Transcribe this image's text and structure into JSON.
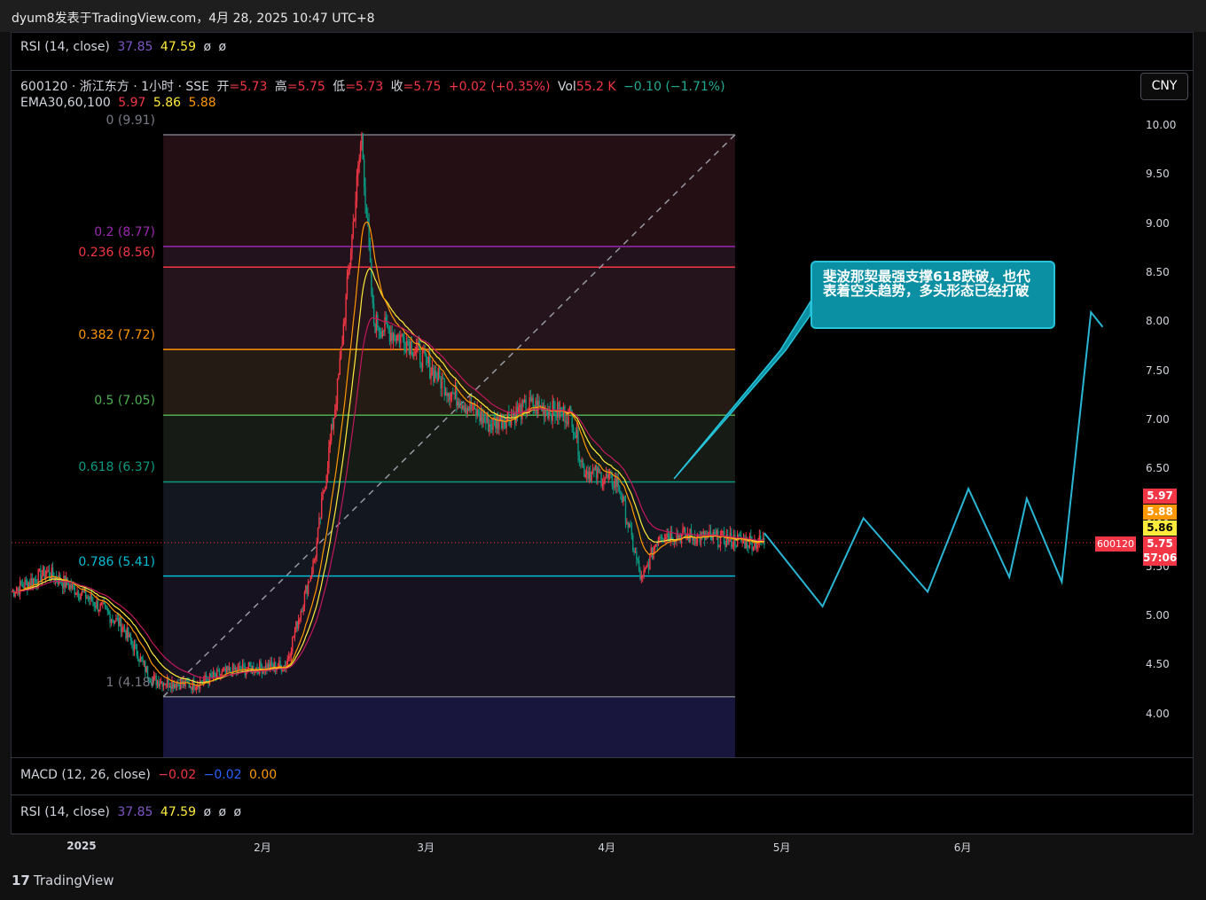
{
  "header": {
    "publish_line": "dyum8发表于TradingView.com，4月 28, 2025 10:47 UTC+8"
  },
  "top_rsi": {
    "label": "RSI (14, close)",
    "v1": "37.85",
    "v2": "47.59",
    "e1": "ø",
    "e2": "ø"
  },
  "symbol_legend": {
    "title": "600120 · 浙江东方 · 1小时 · SSE",
    "open_label": "开",
    "open": "=5.73",
    "high_label": "高",
    "high": "=5.75",
    "low_label": "低",
    "low": "=5.73",
    "close_label": "收",
    "close": "=5.75",
    "change": "+0.02 (+0.35%)",
    "vol_label": "Vol",
    "vol": "55.2 K",
    "vol_change": "−0.10 (−1.71%)"
  },
  "ema_legend": {
    "label": "EMA30,60,100",
    "e30": "5.97",
    "e60": "5.86",
    "e100": "5.88"
  },
  "currency_button": "CNY",
  "fib_levels": [
    {
      "label": "0 (9.91)",
      "price": 9.91,
      "color": "#787b86"
    },
    {
      "label": "0.2 (8.77)",
      "price": 8.77,
      "color": "#9c27b0"
    },
    {
      "label": "0.236 (8.56)",
      "price": 8.56,
      "color": "#f23645"
    },
    {
      "label": "0.382 (7.72)",
      "price": 7.72,
      "color": "#ff9800"
    },
    {
      "label": "0.5 (7.05)",
      "price": 7.05,
      "color": "#4caf50"
    },
    {
      "label": "0.618 (6.37)",
      "price": 6.37,
      "color": "#089981"
    },
    {
      "label": "0.786 (5.41)",
      "price": 5.41,
      "color": "#00bcd4"
    },
    {
      "label": "1 (4.18)",
      "price": 4.18,
      "color": "#787b86"
    }
  ],
  "annotation": "斐波那契最强支撑618跌破，也代表着空头趋势，多头形态已经打破",
  "price_boxes": {
    "ema30": {
      "value": "5.97",
      "color": "#f23645"
    },
    "ema100": {
      "value": "5.88",
      "color": "#ff9800"
    },
    "ema60": {
      "value": "5.86",
      "color": "#ffeb3b"
    },
    "last": {
      "value": "5.75",
      "countdown": "57:06",
      "color": "#f23645"
    },
    "symbol_tag": "600120"
  },
  "macd": {
    "label": "MACD (12, 26, close)",
    "v1": "−0.02",
    "v2": "−0.02",
    "v3": "0.00"
  },
  "bottom_rsi": {
    "label": "RSI (14, close)",
    "v1": "37.85",
    "v2": "47.59",
    "e1": "ø",
    "e2": "ø",
    "e3": "ø"
  },
  "logo_text": "TradingView",
  "chart_data": {
    "type": "candlestick",
    "symbol": "600120",
    "interval": "1小时",
    "y_ticks": [
      10.0,
      9.5,
      9.0,
      8.5,
      8.0,
      7.5,
      7.0,
      6.5,
      6.0,
      5.5,
      5.0,
      4.5,
      4.0
    ],
    "ylim": [
      3.55,
      10.05
    ],
    "x_ticks": [
      "2025",
      "2月",
      "3月",
      "4月",
      "5月",
      "6月"
    ],
    "price_path": [
      {
        "t": "2024-12-20",
        "p": 5.25
      },
      {
        "t": "2024-12-26",
        "p": 5.45
      },
      {
        "t": "2025-01-02",
        "p": 5.2
      },
      {
        "t": "2025-01-08",
        "p": 4.9
      },
      {
        "t": "2025-01-13",
        "p": 4.35
      },
      {
        "t": "2025-01-20",
        "p": 4.3
      },
      {
        "t": "2025-01-27",
        "p": 4.45
      },
      {
        "t": "2025-02-05",
        "p": 4.5
      },
      {
        "t": "2025-02-10",
        "p": 5.6
      },
      {
        "t": "2025-02-14",
        "p": 7.4
      },
      {
        "t": "2025-02-18",
        "p": 9.91
      },
      {
        "t": "2025-02-20",
        "p": 8.0
      },
      {
        "t": "2025-02-26",
        "p": 7.8
      },
      {
        "t": "2025-03-05",
        "p": 7.3
      },
      {
        "t": "2025-03-12",
        "p": 6.95
      },
      {
        "t": "2025-03-19",
        "p": 7.15
      },
      {
        "t": "2025-03-26",
        "p": 7.05
      },
      {
        "t": "2025-03-28",
        "p": 6.5
      },
      {
        "t": "2025-04-03",
        "p": 6.35
      },
      {
        "t": "2025-04-07",
        "p": 5.35
      },
      {
        "t": "2025-04-10",
        "p": 5.85
      },
      {
        "t": "2025-04-18",
        "p": 5.8
      },
      {
        "t": "2025-04-28",
        "p": 5.75
      }
    ],
    "projection": [
      {
        "t": "2025-04-28",
        "p": 5.85
      },
      {
        "t": "2025-05-08",
        "p": 5.1
      },
      {
        "t": "2025-05-15",
        "p": 6.0
      },
      {
        "t": "2025-05-26",
        "p": 5.25
      },
      {
        "t": "2025-06-02",
        "p": 6.3
      },
      {
        "t": "2025-06-09",
        "p": 5.4
      },
      {
        "t": "2025-06-12",
        "p": 6.2
      },
      {
        "t": "2025-06-18",
        "p": 5.35
      },
      {
        "t": "2025-06-23",
        "p": 8.1
      },
      {
        "t": "2025-06-25",
        "p": 7.95
      }
    ],
    "last_price": 5.75
  }
}
